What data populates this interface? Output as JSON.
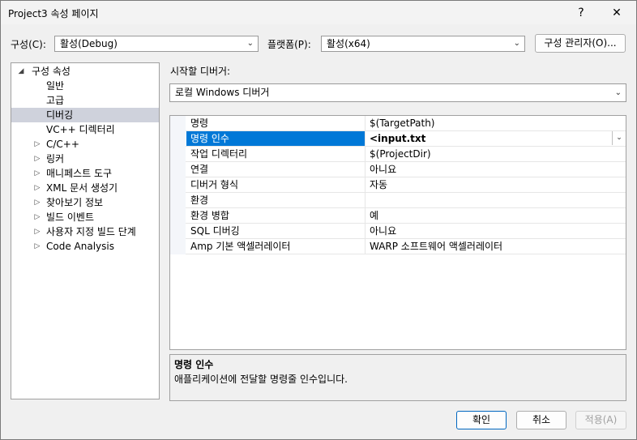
{
  "window": {
    "title": "Project3 속성 페이지",
    "help_glyph": "?",
    "close_glyph": "✕"
  },
  "toolbar": {
    "config_label": "구성(C):",
    "config_value": "활성(Debug)",
    "platform_label": "플랫폼(P):",
    "platform_value": "활성(x64)",
    "config_manager_label": "구성 관리자(O)..."
  },
  "tree": {
    "root": "구성 속성",
    "items": [
      {
        "label": "일반",
        "expandable": false
      },
      {
        "label": "고급",
        "expandable": false
      },
      {
        "label": "디버깅",
        "expandable": false,
        "selected": true
      },
      {
        "label": "VC++ 디렉터리",
        "expandable": false
      },
      {
        "label": "C/C++",
        "expandable": true
      },
      {
        "label": "링커",
        "expandable": true
      },
      {
        "label": "매니페스트 도구",
        "expandable": true
      },
      {
        "label": "XML 문서 생성기",
        "expandable": true
      },
      {
        "label": "찾아보기 정보",
        "expandable": true
      },
      {
        "label": "빌드 이벤트",
        "expandable": true
      },
      {
        "label": "사용자 지정 빌드 단계",
        "expandable": true
      },
      {
        "label": "Code Analysis",
        "expandable": true
      }
    ]
  },
  "debugger": {
    "label": "시작할 디버거:",
    "value": "로컬 Windows 디버거"
  },
  "properties": [
    {
      "name": "명령",
      "value": "$(TargetPath)"
    },
    {
      "name": "명령 인수",
      "value": "<input.txt",
      "selected": true
    },
    {
      "name": "작업 디렉터리",
      "value": "$(ProjectDir)"
    },
    {
      "name": "연결",
      "value": "아니요"
    },
    {
      "name": "디버거 형식",
      "value": "자동"
    },
    {
      "name": "환경",
      "value": ""
    },
    {
      "name": "환경 병합",
      "value": "예"
    },
    {
      "name": "SQL 디버깅",
      "value": "아니요"
    },
    {
      "name": "Amp 기본 액셀러레이터",
      "value": "WARP 소프트웨어 액셀러레이터"
    }
  ],
  "description": {
    "title": "명령 인수",
    "text": "애플리케이션에 전달할 명령줄 인수입니다."
  },
  "buttons": {
    "ok": "확인",
    "cancel": "취소",
    "apply": "적용(A)"
  }
}
